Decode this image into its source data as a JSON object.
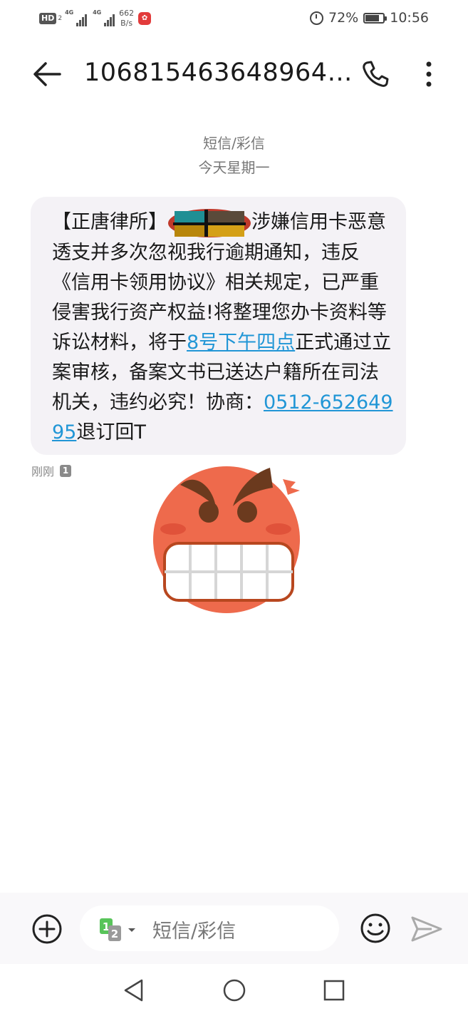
{
  "status_bar": {
    "hd_label": "HD",
    "hd_sub": "2",
    "network1": "4G",
    "network2": "4G",
    "speed_value": "662",
    "speed_unit": "B/s",
    "battery": "72%",
    "time": "10:56"
  },
  "header": {
    "title": "106815463648964…",
    "back_icon": "arrow-left-icon",
    "call_icon": "phone-icon",
    "more_icon": "more-vertical-icon"
  },
  "conversation": {
    "type_label": "短信/彩信",
    "date_label": "今天星期一",
    "message": {
      "part1": "【正唐律所】",
      "part2": "涉嫌信用卡恶意透支并多次忽视我行逾期通知，违反《信用卡领用协议》相关规定，已严重侵害我行资产权益!将整理您办卡资料等诉讼材料，将于",
      "link_time": "8号下午四点",
      "part3": "正式通过立案审核，备案文书已送达户籍所在司法机关，违约必究！协商：",
      "link_phone": "0512-65264995",
      "part4": "退订回T"
    },
    "timestamp": "刚刚",
    "sim_number": "1",
    "sticker": "angry-face-sticker"
  },
  "compose": {
    "placeholder": "短信/彩信",
    "sim_selector": "1 2",
    "icons": [
      "plus-circle-icon",
      "sim-card-icon",
      "smiley-icon",
      "send-icon"
    ]
  },
  "nav": {
    "icons": [
      "nav-back-icon",
      "nav-home-icon",
      "nav-recent-icon"
    ]
  },
  "colors": {
    "link": "#2196d6",
    "bubble": "#f4f2f6",
    "sticker_face": "#ee6a4c"
  }
}
